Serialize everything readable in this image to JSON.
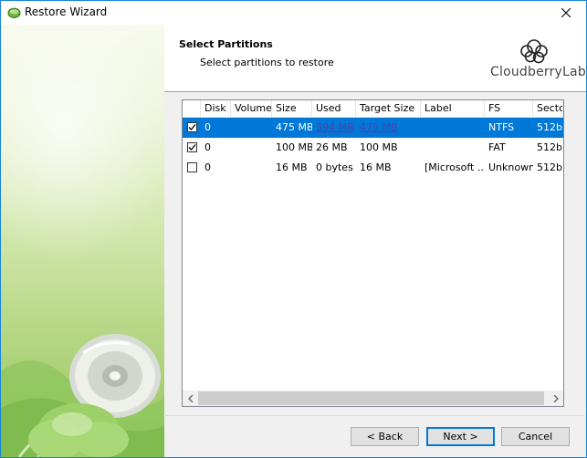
{
  "window": {
    "title": "Restore Wizard",
    "close_glyph": "✕"
  },
  "header": {
    "title": "Select Partitions",
    "subtitle": "Select partitions to restore",
    "logo_text": "CloudberryLab"
  },
  "table": {
    "columns": [
      "Disk",
      "Volume",
      "Size",
      "Used",
      "Target Size",
      "Label",
      "FS",
      "Sector"
    ],
    "rows": [
      {
        "checked": true,
        "selected": true,
        "disk": "0",
        "volume": "",
        "size": "475 MB",
        "used": "394 MB",
        "target": "475 MB",
        "label": "",
        "fs": "NTFS",
        "sector": "512b"
      },
      {
        "checked": true,
        "selected": false,
        "disk": "0",
        "volume": "",
        "size": "100 MB",
        "used": "26 MB",
        "target": "100 MB",
        "label": "",
        "fs": "FAT",
        "sector": "512b"
      },
      {
        "checked": false,
        "selected": false,
        "disk": "0",
        "volume": "",
        "size": "16 MB",
        "used": "0 bytes",
        "target": "16 MB",
        "label": "[Microsoft ...",
        "fs": "Unknown",
        "sector": "512b"
      }
    ]
  },
  "buttons": {
    "back": "< Back",
    "next": "Next >",
    "cancel": "Cancel"
  },
  "colors": {
    "selection": "#0078d7",
    "accent_border": "#1883d7"
  }
}
